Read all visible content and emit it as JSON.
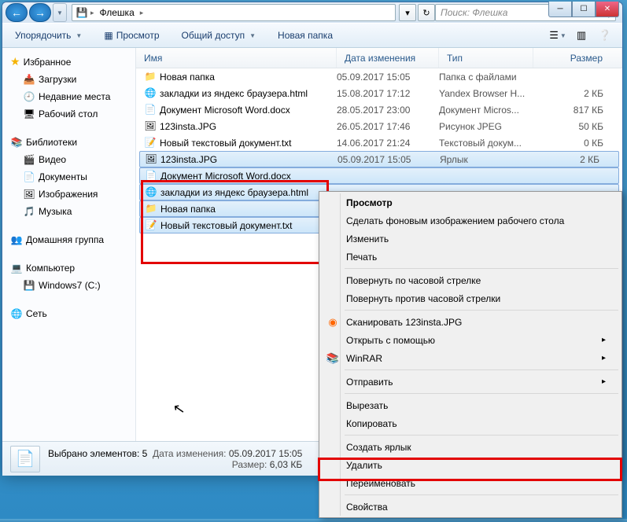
{
  "window": {
    "title": "Флешка",
    "breadcrumb": [
      "Флешка"
    ],
    "search_placeholder": "Поиск: Флешка"
  },
  "toolbar": {
    "organize": "Упорядочить",
    "preview": "Просмотр",
    "share": "Общий доступ",
    "new_folder": "Новая папка"
  },
  "sidebar": {
    "favorites": {
      "label": "Избранное",
      "items": [
        "Загрузки",
        "Недавние места",
        "Рабочий стол"
      ]
    },
    "libraries": {
      "label": "Библиотеки",
      "items": [
        "Видео",
        "Документы",
        "Изображения",
        "Музыка"
      ]
    },
    "homegroup": "Домашняя группа",
    "computer": {
      "label": "Компьютер",
      "items": [
        "Windows7 (C:)"
      ]
    },
    "network": "Сеть"
  },
  "columns": {
    "name": "Имя",
    "date": "Дата изменения",
    "type": "Тип",
    "size": "Размер"
  },
  "files": [
    {
      "icon": "📁",
      "name": "Новая папка",
      "date": "05.09.2017 15:05",
      "type": "Папка с файлами",
      "size": ""
    },
    {
      "icon": "🌐",
      "name": "закладки из яндекс браузера.html",
      "date": "15.08.2017 17:12",
      "type": "Yandex Browser H...",
      "size": "2 КБ"
    },
    {
      "icon": "📄",
      "name": "Документ Microsoft Word.docx",
      "date": "28.05.2017 23:00",
      "type": "Документ Micros...",
      "size": "817 КБ"
    },
    {
      "icon": "🖼",
      "name": "123insta.JPG",
      "date": "26.05.2017 17:46",
      "type": "Рисунок JPEG",
      "size": "50 КБ"
    },
    {
      "icon": "📝",
      "name": "Новый текстовый документ.txt",
      "date": "14.06.2017 21:24",
      "type": "Текстовый докум...",
      "size": "0 КБ"
    },
    {
      "icon": "🖼",
      "name": "123insta.JPG",
      "date": "05.09.2017 15:05",
      "type": "Ярлык",
      "size": "2 КБ",
      "sel": true
    },
    {
      "icon": "📄",
      "name": "Документ Microsoft Word.docx",
      "date": "",
      "type": "",
      "size": "",
      "sel": true
    },
    {
      "icon": "🌐",
      "name": "закладки из яндекс браузера.html",
      "date": "",
      "type": "",
      "size": "",
      "sel": true
    },
    {
      "icon": "📁",
      "name": "Новая папка",
      "date": "",
      "type": "",
      "size": "",
      "sel": true
    },
    {
      "icon": "📝",
      "name": "Новый текстовый документ.txt",
      "date": "",
      "type": "",
      "size": "",
      "sel": true
    }
  ],
  "status": {
    "selected_label": "Выбрано элементов: 5",
    "date_label": "Дата изменения:",
    "date_value": "05.09.2017 15:05",
    "size_label": "Размер:",
    "size_value": "6,03 КБ"
  },
  "context_menu": {
    "view": "Просмотр",
    "set_wallpaper": "Сделать фоновым изображением рабочего стола",
    "edit": "Изменить",
    "print": "Печать",
    "rotate_cw": "Повернуть по часовой стрелке",
    "rotate_ccw": "Повернуть против часовой стрелки",
    "scan": "Сканировать 123insta.JPG",
    "open_with": "Открыть с помощью",
    "winrar": "WinRAR",
    "send_to": "Отправить",
    "cut": "Вырезать",
    "copy": "Копировать",
    "create_shortcut": "Создать ярлык",
    "delete": "Удалить",
    "rename": "Переименовать",
    "properties": "Свойства"
  }
}
